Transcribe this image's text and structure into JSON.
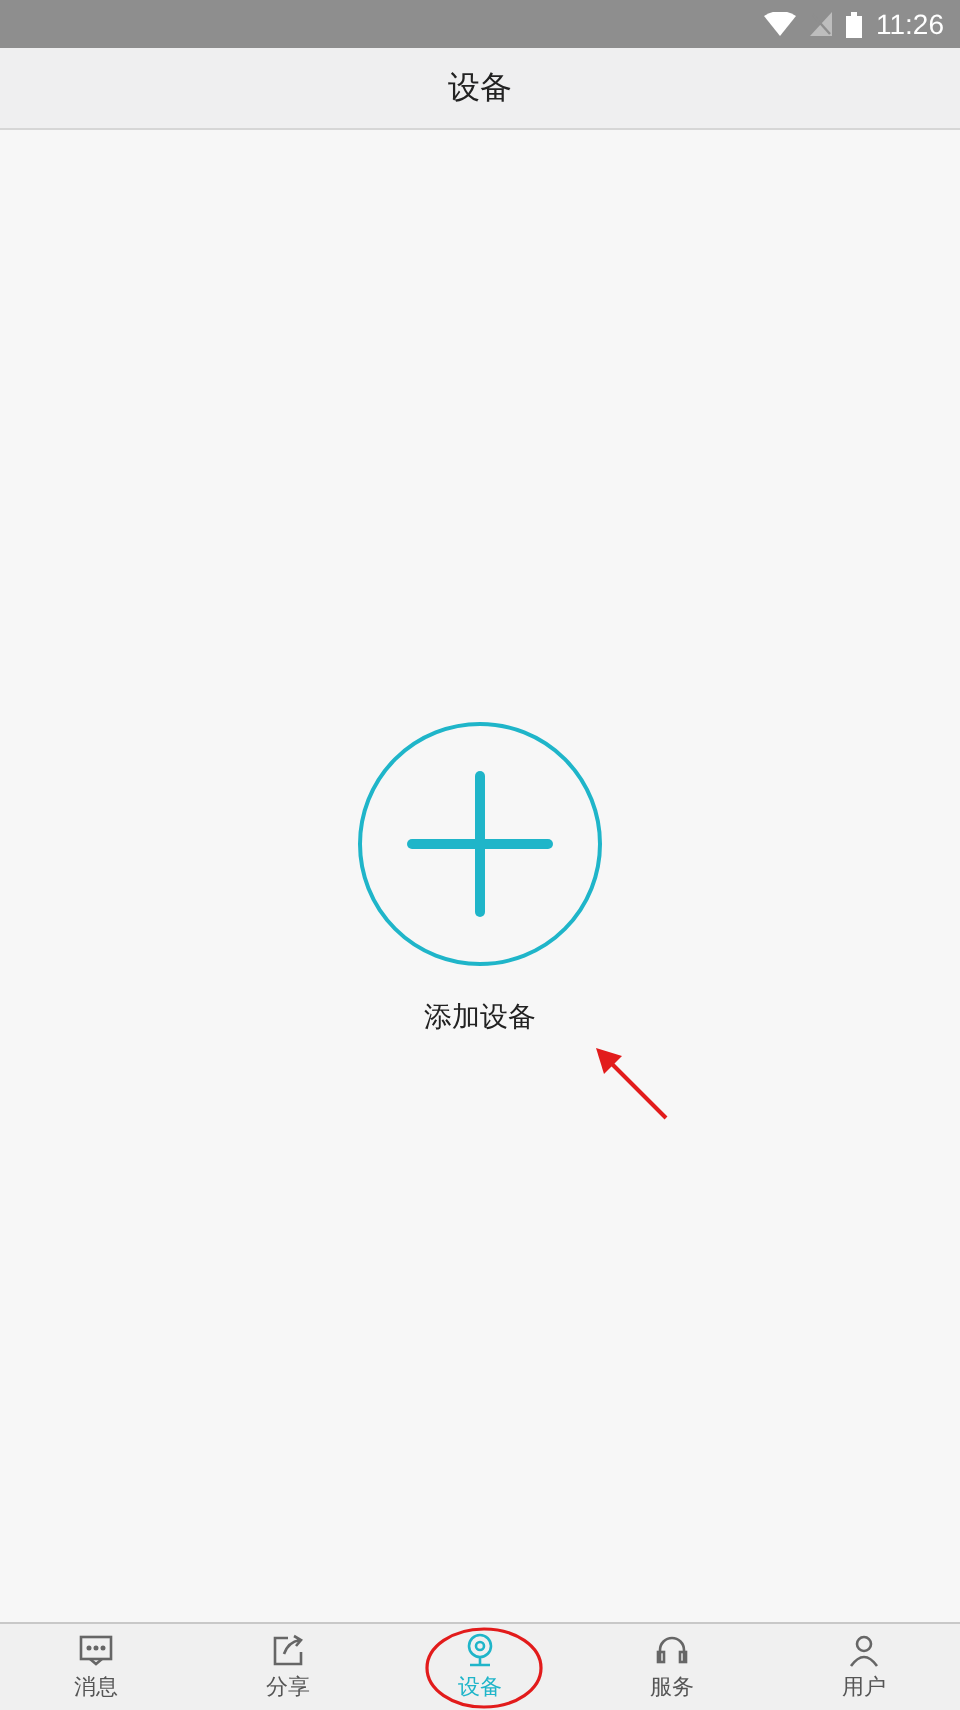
{
  "status_bar": {
    "time": "11:26"
  },
  "header": {
    "title": "设备"
  },
  "add_device": {
    "label": "添加设备"
  },
  "tabs": [
    {
      "label": "消息",
      "kind": "message",
      "selected": false
    },
    {
      "label": "分享",
      "kind": "share",
      "selected": false
    },
    {
      "label": "设备",
      "kind": "device",
      "selected": true
    },
    {
      "label": "服务",
      "kind": "service",
      "selected": false
    },
    {
      "label": "用户",
      "kind": "user",
      "selected": false
    }
  ]
}
